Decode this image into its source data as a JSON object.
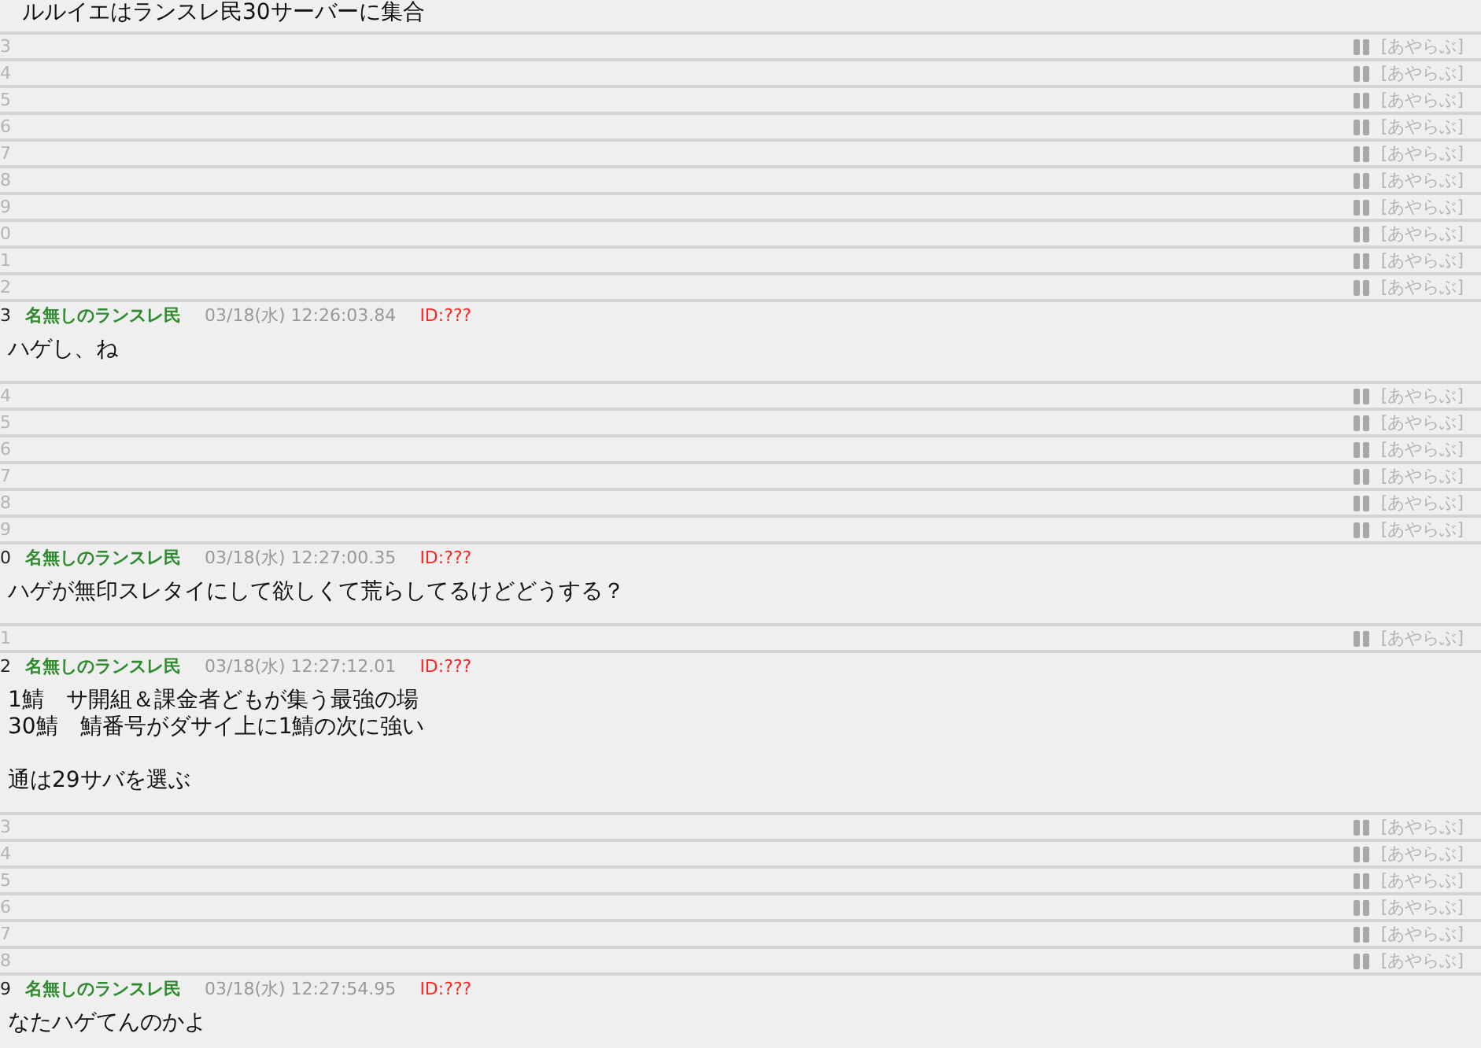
{
  "top_text": "ルルイエはランスレ民30サーバーに集合",
  "posts": [
    {
      "kind": "collapsed",
      "number": "3",
      "link": "[あやらぶ]"
    },
    {
      "kind": "collapsed",
      "number": "4",
      "link": "[あやらぶ]"
    },
    {
      "kind": "collapsed",
      "number": "5",
      "link": "[あやらぶ]"
    },
    {
      "kind": "collapsed",
      "number": "6",
      "link": "[あやらぶ]"
    },
    {
      "kind": "collapsed",
      "number": "7",
      "link": "[あやらぶ]"
    },
    {
      "kind": "collapsed",
      "number": "8",
      "link": "[あやらぶ]"
    },
    {
      "kind": "collapsed",
      "number": "9",
      "link": "[あやらぶ]"
    },
    {
      "kind": "collapsed",
      "number": "0",
      "link": "[あやらぶ]"
    },
    {
      "kind": "collapsed",
      "number": "1",
      "link": "[あやらぶ]"
    },
    {
      "kind": "collapsed",
      "number": "2",
      "link": "[あやらぶ]"
    },
    {
      "kind": "post",
      "number": "3",
      "name": "名無しのランスレ民",
      "date": "03/18(水) 12:26:03.84",
      "id": "ID:???",
      "body": "ハゲし、ね"
    },
    {
      "kind": "collapsed",
      "number": "4",
      "link": "[あやらぶ]"
    },
    {
      "kind": "collapsed",
      "number": "5",
      "link": "[あやらぶ]"
    },
    {
      "kind": "collapsed",
      "number": "6",
      "link": "[あやらぶ]"
    },
    {
      "kind": "collapsed",
      "number": "7",
      "link": "[あやらぶ]"
    },
    {
      "kind": "collapsed",
      "number": "8",
      "link": "[あやらぶ]"
    },
    {
      "kind": "collapsed",
      "number": "9",
      "link": "[あやらぶ]"
    },
    {
      "kind": "post",
      "number": "0",
      "name": "名無しのランスレ民",
      "date": "03/18(水) 12:27:00.35",
      "id": "ID:???",
      "body": "ハゲが無印スレタイにして欲しくて荒らしてるけどどうする？"
    },
    {
      "kind": "collapsed",
      "number": "1",
      "link": "[あやらぶ]"
    },
    {
      "kind": "post",
      "number": "2",
      "name": "名無しのランスレ民",
      "date": "03/18(水) 12:27:12.01",
      "id": "ID:???",
      "paragraphs": [
        [
          "1鯖　サ開組＆課金者どもが集う最強の場",
          "30鯖　鯖番号がダサイ上に1鯖の次に強い"
        ],
        [
          "通は29サバを選ぶ"
        ]
      ]
    },
    {
      "kind": "collapsed",
      "number": "3",
      "link": "[あやらぶ]"
    },
    {
      "kind": "collapsed",
      "number": "4",
      "link": "[あやらぶ]"
    },
    {
      "kind": "collapsed",
      "number": "5",
      "link": "[あやらぶ]"
    },
    {
      "kind": "collapsed",
      "number": "6",
      "link": "[あやらぶ]"
    },
    {
      "kind": "collapsed",
      "number": "7",
      "link": "[あやらぶ]"
    },
    {
      "kind": "collapsed",
      "number": "8",
      "link": "[あやらぶ]"
    },
    {
      "kind": "post",
      "number": "9",
      "name": "名無しのランスレ民",
      "date": "03/18(水) 12:27:54.95",
      "id": "ID:???",
      "body": "なたハゲてんのかよ"
    }
  ]
}
